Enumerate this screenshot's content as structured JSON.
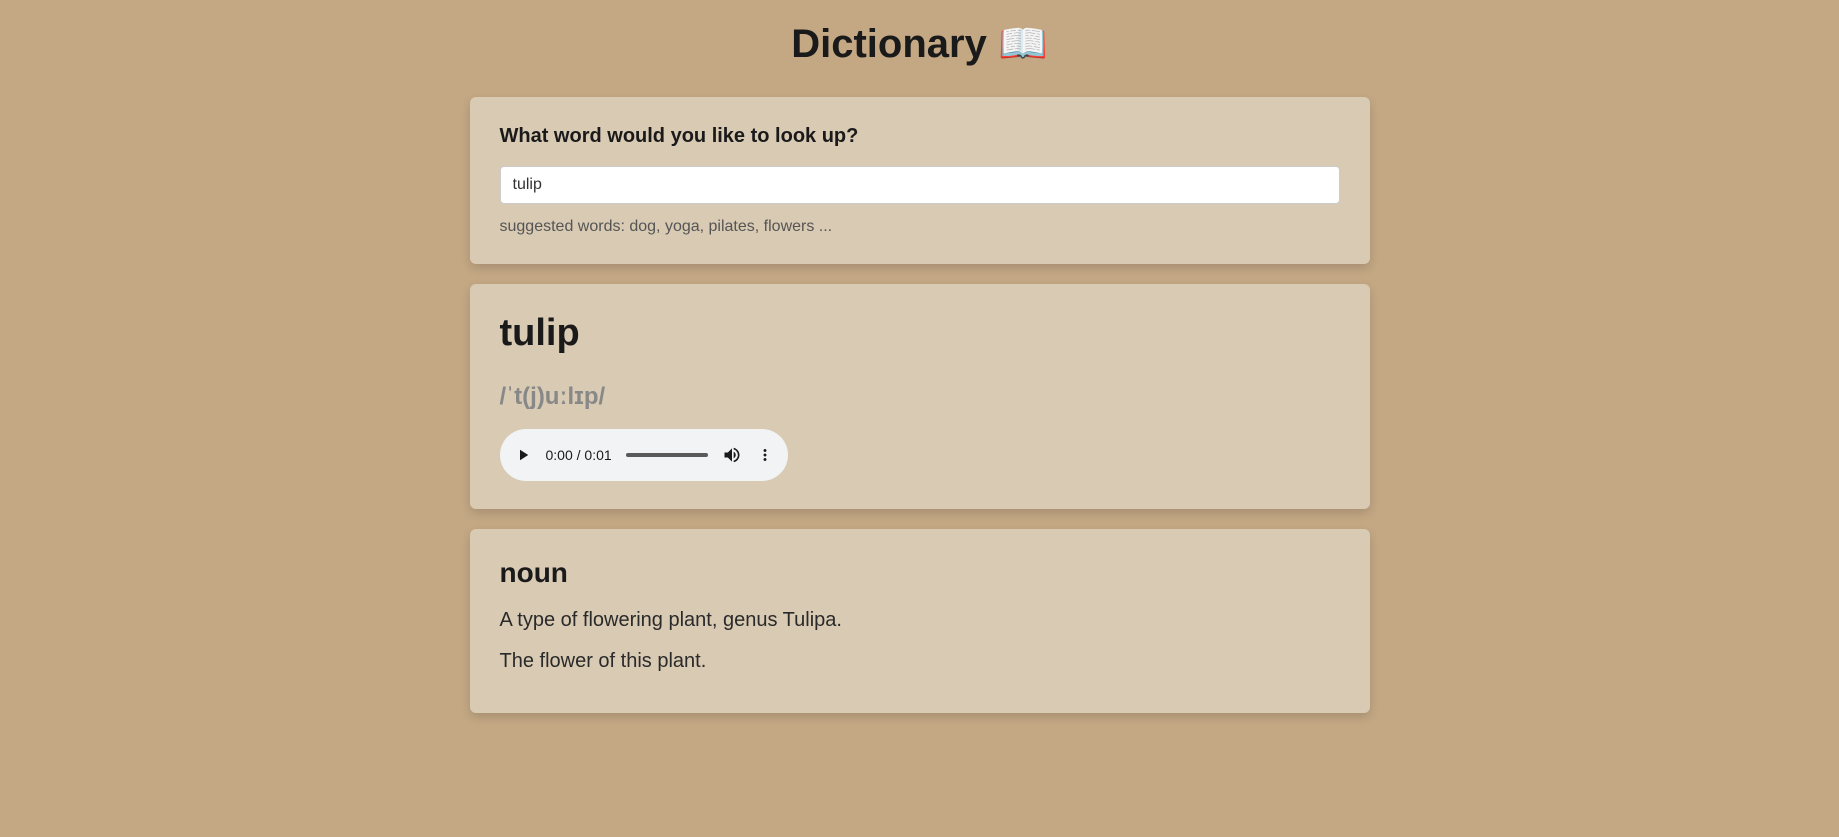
{
  "page": {
    "title": "Dictionary 📖"
  },
  "search": {
    "label": "What word would you like to look up?",
    "value": "tulip",
    "hint": "suggested words: dog, yoga, pilates, flowers ..."
  },
  "result": {
    "word": "tulip",
    "phonetic": "/ˈt(j)uːlɪp/",
    "audio": {
      "time": "0:00 / 0:01"
    }
  },
  "meaning": {
    "partOfSpeech": "noun",
    "definitions": [
      "A type of flowering plant, genus Tulipa.",
      "The flower of this plant."
    ]
  }
}
